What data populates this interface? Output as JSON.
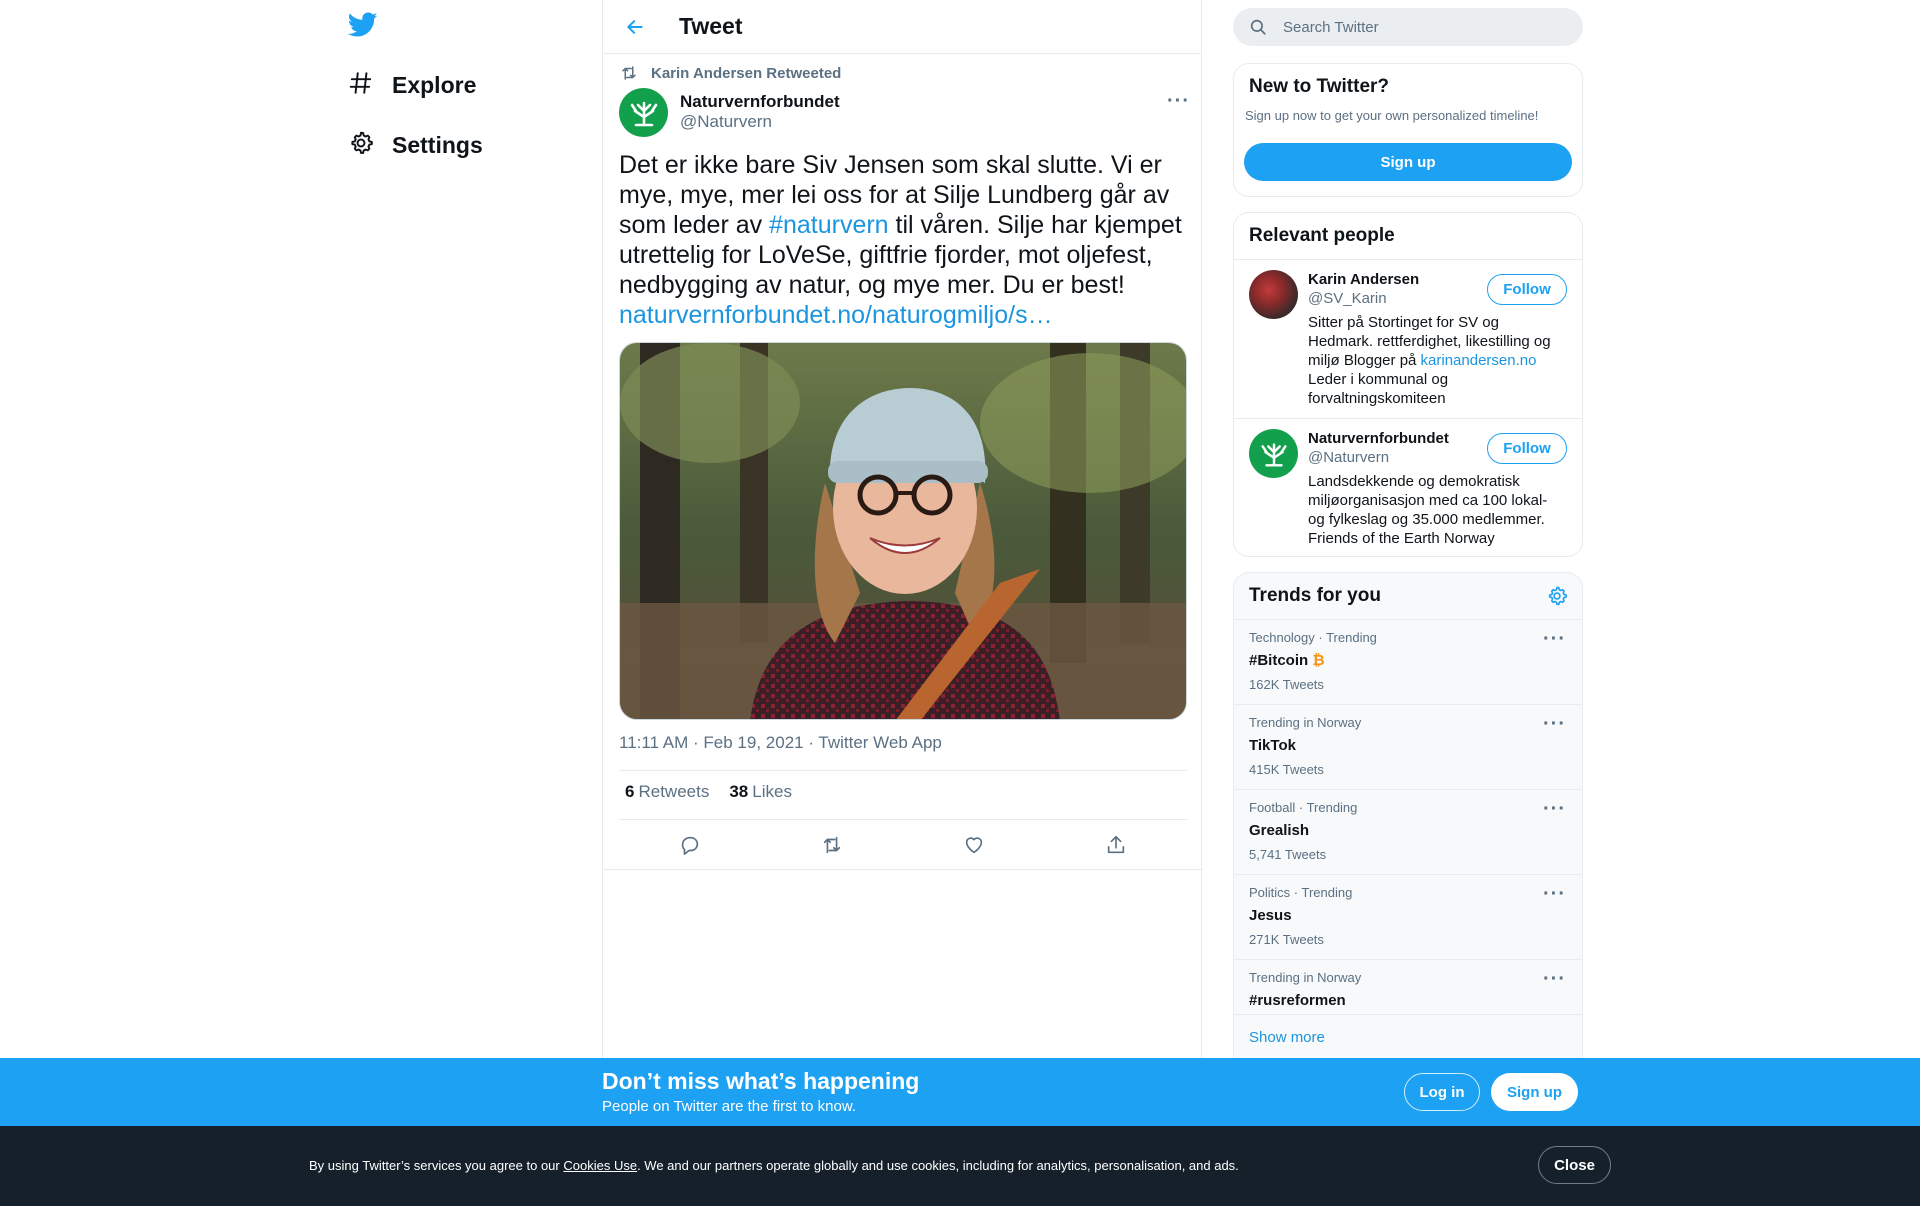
{
  "nav": {
    "logo_icon": "twitter-bird-icon",
    "items": [
      {
        "label": "Explore",
        "icon": "hashtag-icon"
      },
      {
        "label": "Settings",
        "icon": "gear-icon"
      }
    ]
  },
  "header": {
    "back_icon": "back-arrow-icon",
    "title": "Tweet"
  },
  "tweet": {
    "retweeted_by": "Karin Andersen Retweeted",
    "author_name": "Naturvernforbundet",
    "author_handle": "@Naturvern",
    "text_1": "Det er ikke bare Siv Jensen som skal slutte. Vi er mye, mye, mer lei oss for at Silje Lundberg går av som leder av ",
    "hashtag": "#naturvern",
    "text_2": " til våren. Silje har kjempet utrettelig for LoVeSe, giftfrie fjorder, mot oljefest, nedbygging av natur, og mye mer. Du er best!",
    "link": "naturvernforbundet.no/naturogmiljo/s…",
    "timestamp": "11:11 AM · Feb 19, 2021 · Twitter Web App",
    "retweets_count": "6",
    "retweets_label": "Retweets",
    "likes_count": "38",
    "likes_label": "Likes",
    "more": "···"
  },
  "search": {
    "placeholder": "Search Twitter"
  },
  "new_to_twitter": {
    "title": "New to Twitter?",
    "subtitle": "Sign up now to get your own personalized timeline!",
    "button": "Sign up"
  },
  "relevant_people": {
    "title": "Relevant people",
    "people": [
      {
        "name": "Karin Andersen",
        "handle": "@SV_Karin",
        "follow": "Follow",
        "bio_1": "Sitter på Stortinget for SV og Hedmark. rettferdighet, likestilling og miljø Blogger på ",
        "bio_link": "karinandersen.no",
        "bio_2": "Leder i kommunal og forvaltningskomiteen"
      },
      {
        "name": "Naturvernforbundet",
        "handle": "@Naturvern",
        "follow": "Follow",
        "bio_1": "Landsdekkende og demokratisk miljøorganisasjon med ca 100 lokal- og fylkeslag og 35.000 medlemmer. Friends of the Earth Norway"
      }
    ]
  },
  "trends": {
    "title": "Trends for you",
    "items": [
      {
        "context": "Technology · Trending",
        "name": "#Bitcoin",
        "count": "162K Tweets"
      },
      {
        "context": "Trending in Norway",
        "name": "TikTok",
        "count": "415K Tweets"
      },
      {
        "context": "Football · Trending",
        "name": "Grealish",
        "count": "5,741 Tweets"
      },
      {
        "context": "Politics · Trending",
        "name": "Jesus",
        "count": "271K Tweets"
      },
      {
        "context": "Trending in Norway",
        "name": "#rusreformen",
        "count": ""
      }
    ],
    "show_more": "Show more"
  },
  "signup_banner": {
    "title": "Don’t miss what’s happening",
    "subtitle": "People on Twitter are the first to know.",
    "login": "Log in",
    "signup": "Sign up"
  },
  "cookie_bar": {
    "text_1": "By using Twitter’s services you agree to our ",
    "link": "Cookies Use",
    "text_2": ". We and our partners operate globally and use cookies, including for analytics, personalisation, and ads.",
    "close": "Close"
  },
  "colors": {
    "accent": "#1da1f2",
    "link": "#1b95e0",
    "secondary": "#5b7083",
    "bitcoin": "#f7931a",
    "cookie_bg": "#15202b"
  }
}
